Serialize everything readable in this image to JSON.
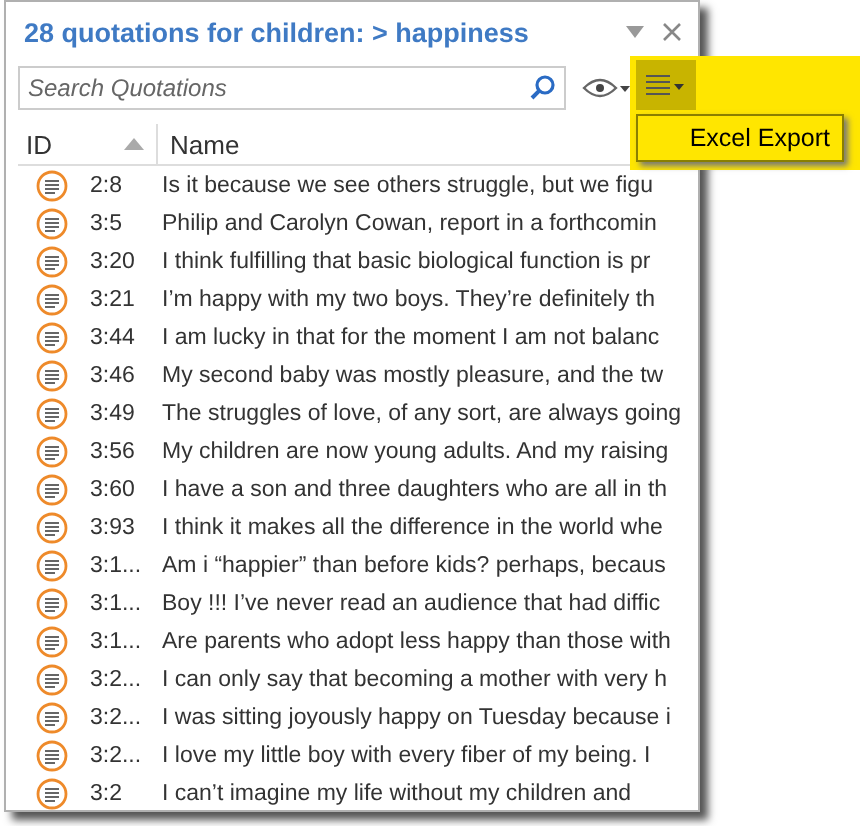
{
  "panel": {
    "title": "28 quotations for children: > happiness"
  },
  "search": {
    "placeholder": "Search Quotations"
  },
  "menu": {
    "items": [
      "Excel Export"
    ]
  },
  "table": {
    "columns": [
      "ID",
      "Name"
    ],
    "rows": [
      {
        "id": "2:8",
        "name": "Is it because we see others struggle, but we figu"
      },
      {
        "id": "3:5",
        "name": "Philip and Carolyn Cowan, report in a forthcomin"
      },
      {
        "id": "3:20",
        "name": "I think fulfilling that basic biological function is pr"
      },
      {
        "id": "3:21",
        "name": "I’m happy with my two boys. They’re definitely th"
      },
      {
        "id": "3:44",
        "name": "I am lucky in that for the moment I am not balanc"
      },
      {
        "id": "3:46",
        "name": "My second baby was mostly pleasure, and the tw"
      },
      {
        "id": "3:49",
        "name": "The struggles of love, of any sort, are always going"
      },
      {
        "id": "3:56",
        "name": "My children are now young adults. And my raising"
      },
      {
        "id": "3:60",
        "name": "I have a son and three daughters who are all in th"
      },
      {
        "id": "3:93",
        "name": "I think it makes all the difference in the world whe"
      },
      {
        "id": "3:1...",
        "name": "Am i “happier” than before kids? perhaps, becaus"
      },
      {
        "id": "3:1...",
        "name": "Boy !!! I’ve never read an audience that had diffic"
      },
      {
        "id": "3:1...",
        "name": "Are parents who adopt less happy than those with"
      },
      {
        "id": "3:2...",
        "name": "I can only say that becoming a mother with very h"
      },
      {
        "id": "3:2...",
        "name": "I was sitting joyously happy on Tuesday because i"
      },
      {
        "id": "3:2...",
        "name": "I love my little boy with every fiber of my being. I"
      },
      {
        "id": "3:2",
        "name": "I can’t imagine my life without my children and"
      }
    ]
  }
}
